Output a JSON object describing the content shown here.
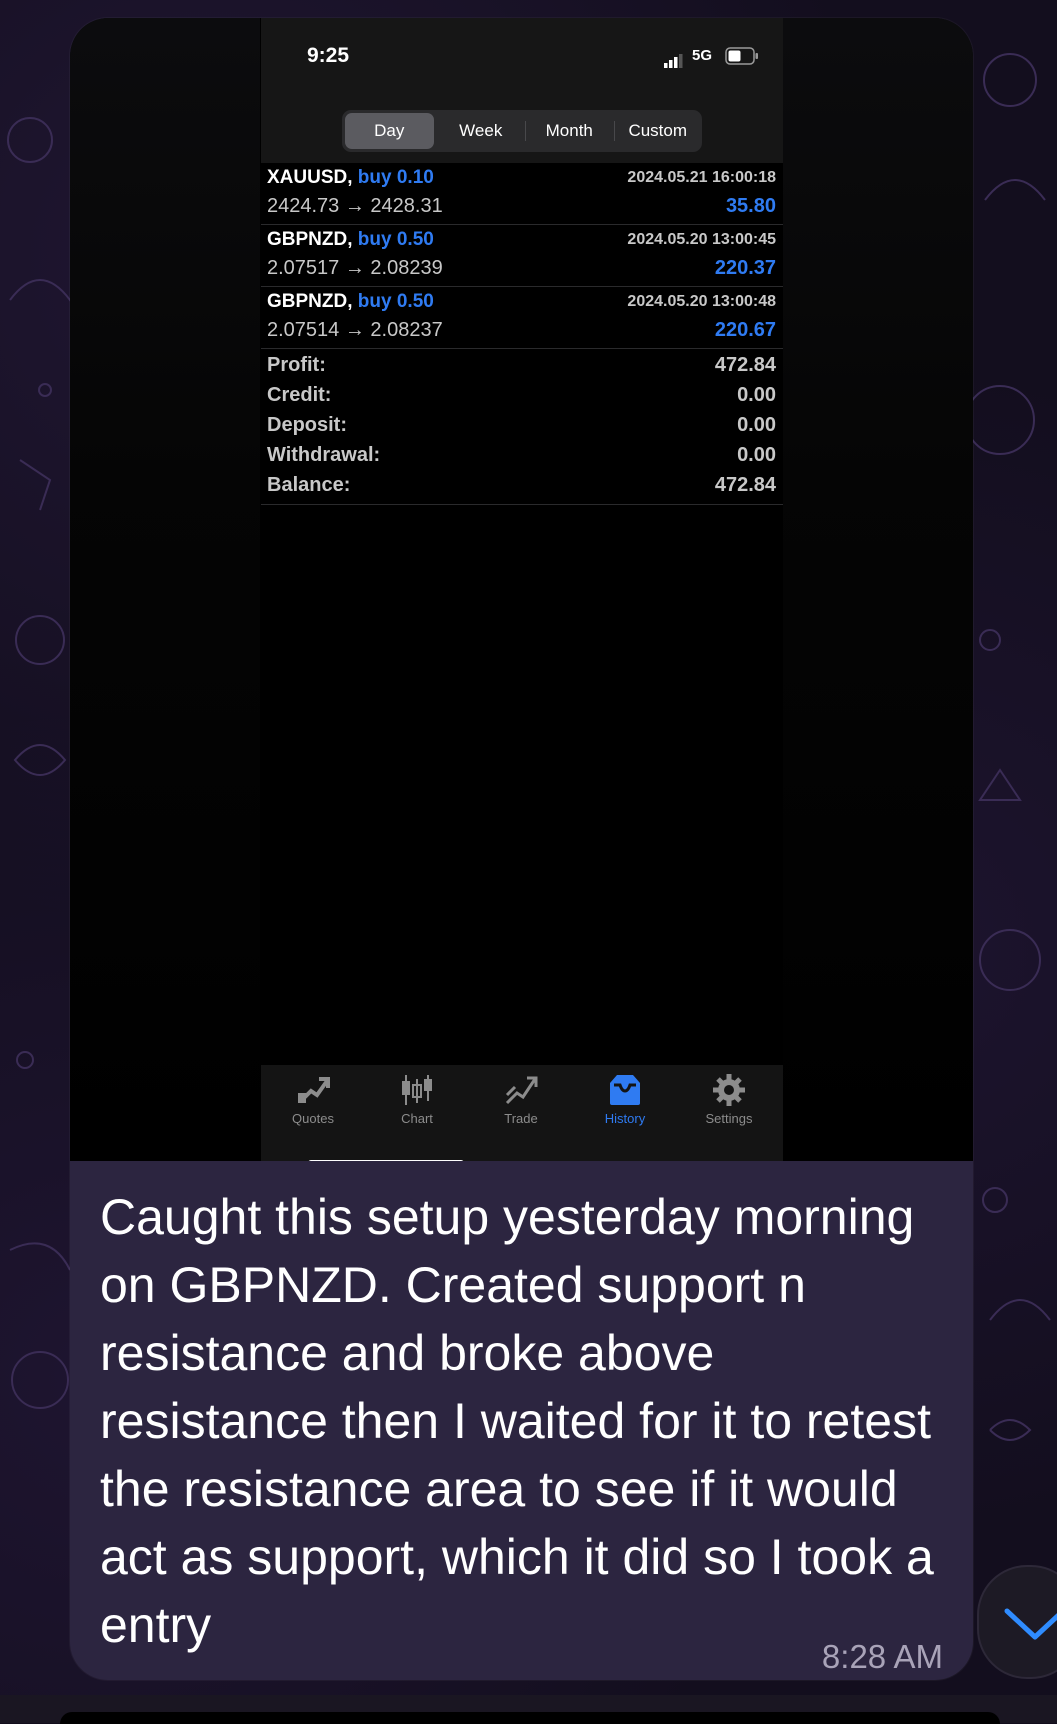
{
  "status_bar": {
    "time": "9:25",
    "network": "5G"
  },
  "segmented": {
    "options": [
      "Day",
      "Week",
      "Month",
      "Custom"
    ],
    "selected": "Day"
  },
  "trades": [
    {
      "symbol": "XAUUSD,",
      "direction": "buy",
      "lot": "0.10",
      "open_price": "2424.73",
      "close_price": "2428.31",
      "datetime": "2024.05.21 16:00:18",
      "profit": "35.80"
    },
    {
      "symbol": "GBPNZD,",
      "direction": "buy",
      "lot": "0.50",
      "open_price": "2.07517",
      "close_price": "2.08239",
      "datetime": "2024.05.20 13:00:45",
      "profit": "220.37"
    },
    {
      "symbol": "GBPNZD,",
      "direction": "buy",
      "lot": "0.50",
      "open_price": "2.07514",
      "close_price": "2.08237",
      "datetime": "2024.05.20 13:00:48",
      "profit": "220.67"
    }
  ],
  "summary": [
    {
      "label": "Profit:",
      "value": "472.84"
    },
    {
      "label": "Credit:",
      "value": "0.00"
    },
    {
      "label": "Deposit:",
      "value": "0.00"
    },
    {
      "label": "Withdrawal:",
      "value": "0.00"
    },
    {
      "label": "Balance:",
      "value": "472.84"
    }
  ],
  "tabbar": {
    "tabs": [
      {
        "label": "Quotes",
        "icon": "quotes-icon"
      },
      {
        "label": "Chart",
        "icon": "candlestick-icon"
      },
      {
        "label": "Trade",
        "icon": "trade-icon"
      },
      {
        "label": "History",
        "icon": "inbox-icon"
      },
      {
        "label": "Settings",
        "icon": "gear-icon"
      }
    ],
    "active": "History"
  },
  "message": {
    "text": "Caught this setup yesterday morning on GBPNZD. Created support n resistance and broke above resistance then I waited for it to retest the resistance area to see if it would act as support, which it did so I took a entry",
    "time": "8:28 AM"
  },
  "colors": {
    "accent_blue": "#2f7bf2",
    "bubble": "#2c2540",
    "background": "#130e1e"
  }
}
